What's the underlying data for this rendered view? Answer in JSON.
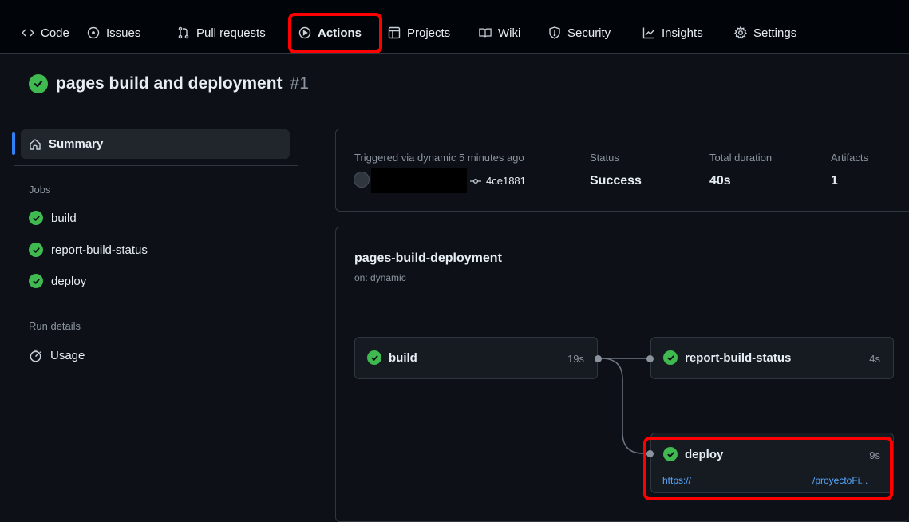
{
  "nav": {
    "tabs": [
      {
        "label": "Code",
        "icon": "code-icon"
      },
      {
        "label": "Issues",
        "icon": "issue-opened-icon"
      },
      {
        "label": "Pull requests",
        "icon": "git-pull-request-icon"
      },
      {
        "label": "Actions",
        "icon": "play-icon"
      },
      {
        "label": "Projects",
        "icon": "table-icon"
      },
      {
        "label": "Wiki",
        "icon": "book-icon"
      },
      {
        "label": "Security",
        "icon": "shield-icon"
      },
      {
        "label": "Insights",
        "icon": "graph-icon"
      },
      {
        "label": "Settings",
        "icon": "gear-icon"
      }
    ],
    "active": "Actions"
  },
  "run": {
    "title": "pages build and deployment",
    "number": "#1"
  },
  "sidebar": {
    "summary_label": "Summary",
    "jobs_heading": "Jobs",
    "jobs": [
      "build",
      "report-build-status",
      "deploy"
    ],
    "run_details_heading": "Run details",
    "usage_label": "Usage"
  },
  "summary": {
    "triggered_label": "Triggered via dynamic 5 minutes ago",
    "commit": "4ce1881",
    "status_label": "Status",
    "status_value": "Success",
    "duration_label": "Total duration",
    "duration_value": "40s",
    "artifacts_label": "Artifacts",
    "artifacts_value": "1"
  },
  "workflow": {
    "name": "pages-build-deployment",
    "trigger": "on: dynamic",
    "jobs": {
      "build": {
        "name": "build",
        "duration": "19s"
      },
      "report": {
        "name": "report-build-status",
        "duration": "4s"
      },
      "deploy": {
        "name": "deploy",
        "duration": "9s",
        "url_prefix": "https://",
        "url_suffix": "/proyectoFi..."
      }
    }
  },
  "colors": {
    "success": "#3fb950",
    "highlight": "#ff0000",
    "link": "#58a6ff"
  }
}
